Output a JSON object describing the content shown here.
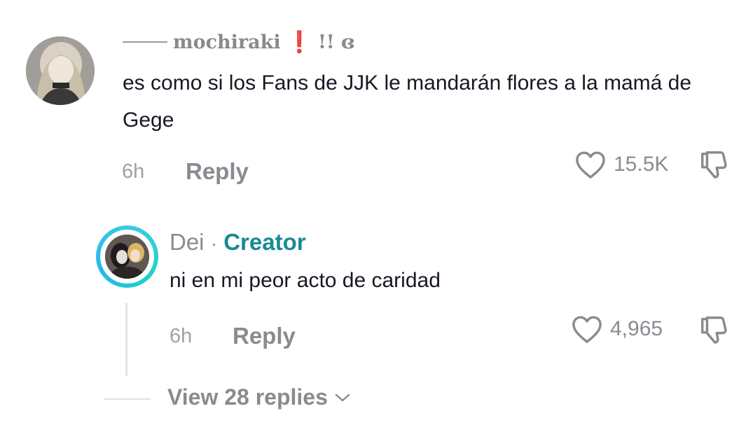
{
  "comment": {
    "username": "mochiraki",
    "username_suffix": "!! ɞ",
    "text": "es como si los Fans de JJK le mandarán flores a la mamá de Gege",
    "time": "6h",
    "reply_label": "Reply",
    "likes": "15.5K"
  },
  "reply": {
    "username": "Dei",
    "separator": "·",
    "badge": "Creator",
    "text": "ni en mi peor acto de caridad",
    "time": "6h",
    "reply_label": "Reply",
    "likes": "4,965"
  },
  "thread": {
    "view_replies_label": "View 28 replies"
  },
  "icons": {
    "like": "heart-outline-icon",
    "dislike": "thumbs-down-icon",
    "expand": "chevron-down-icon"
  },
  "colors": {
    "text": "#161823",
    "muted": "#8a8b91",
    "creator": "#1a8a96",
    "ring": "#3cc9e8"
  }
}
